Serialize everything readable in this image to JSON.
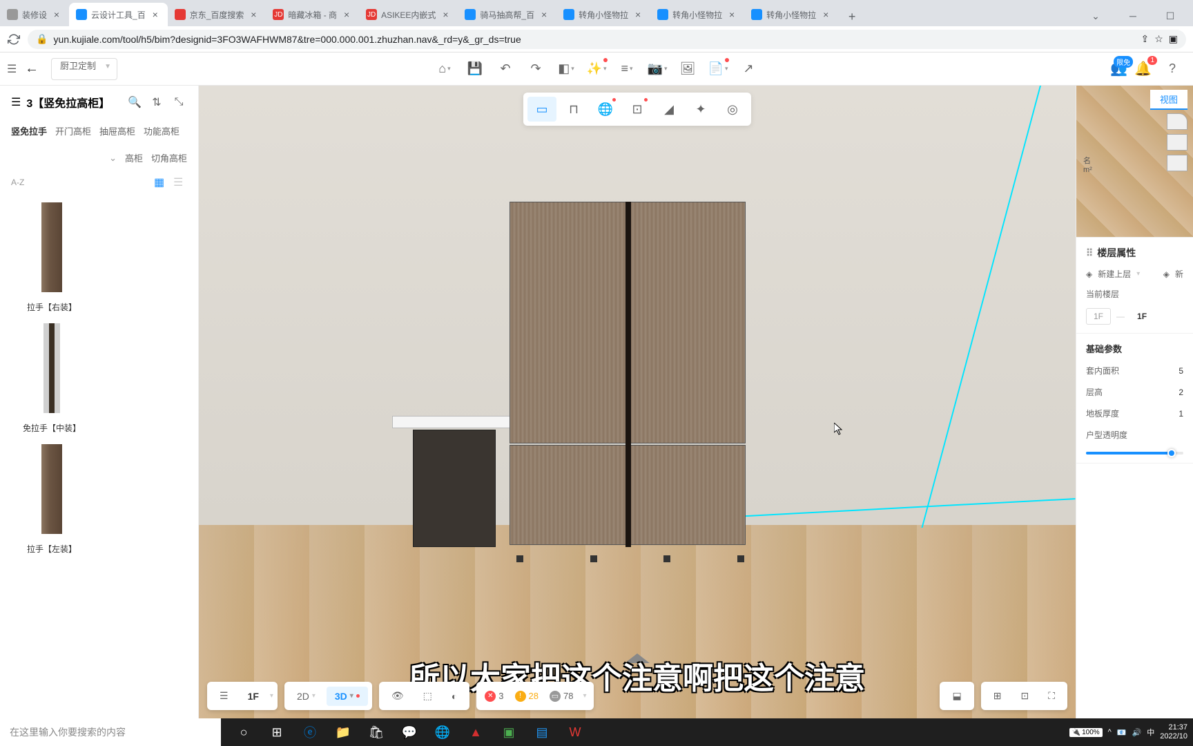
{
  "browser": {
    "tabs": [
      {
        "title": "装修设",
        "favicon_bg": "#999"
      },
      {
        "title": "云设计工具_百",
        "favicon_bg": "#1890ff",
        "active": true
      },
      {
        "title": "京东_百度搜索",
        "favicon_bg": "#e53935"
      },
      {
        "title": "暗藏冰箱 - 商",
        "favicon_bg": "#e53935",
        "favicon_text": "JD"
      },
      {
        "title": "ASIKEE内嵌式",
        "favicon_bg": "#e53935",
        "favicon_text": "JD"
      },
      {
        "title": "骑马抽高帮_百",
        "favicon_bg": "#1890ff"
      },
      {
        "title": "转角小怪物拉",
        "favicon_bg": "#1890ff"
      },
      {
        "title": "转角小怪物拉",
        "favicon_bg": "#1890ff"
      },
      {
        "title": "转角小怪物拉",
        "favicon_bg": "#1890ff"
      }
    ],
    "url": "yun.kujiale.com/tool/h5/bim?designid=3FO3WAFHWM87&tre=000.000.001.zhuzhan.nav&_rd=y&_gr_ds=true"
  },
  "toolbar": {
    "mode": "厨卫定制",
    "badge_free": "限免",
    "badge_notif": "1"
  },
  "sidebar": {
    "title": "3【竖免拉高柜】",
    "tabs": [
      "竖免拉手",
      "开门高柜",
      "抽屉高柜",
      "功能高柜",
      "高柜",
      "切角高柜"
    ],
    "active_tab": 0,
    "sort": "A-Z",
    "products": [
      {
        "name": "拉手【右装】"
      },
      {
        "name": "免拉手【中装】"
      },
      {
        "name": "拉手【左装】"
      }
    ]
  },
  "subtitle": "所以大家把这个注意啊把这个注意",
  "bottom": {
    "floor": "1F",
    "view2d": "2D",
    "view3d": "3D",
    "stat_error": "3",
    "stat_warn": "28",
    "stat_count": "78"
  },
  "right": {
    "view_tab": "视图",
    "mm_label1": "名",
    "mm_label2": "m²",
    "properties_title": "楼层属性",
    "new_upper": "新建上层",
    "new_btn": "新",
    "current_floor_label": "当前楼层",
    "floor_1f": "1F",
    "floor_sel": "1F",
    "params_title": "基础参数",
    "area_label": "套内面积",
    "area_val": "5",
    "height_label": "层高",
    "height_val": "2",
    "thickness_label": "地板厚度",
    "thickness_val": "1",
    "opacity_label": "户型透明度"
  },
  "taskbar": {
    "search_placeholder": "在这里输入你要搜索的内容",
    "battery": "100%",
    "ime": "中",
    "time": "21:37",
    "date": "2022/10"
  }
}
